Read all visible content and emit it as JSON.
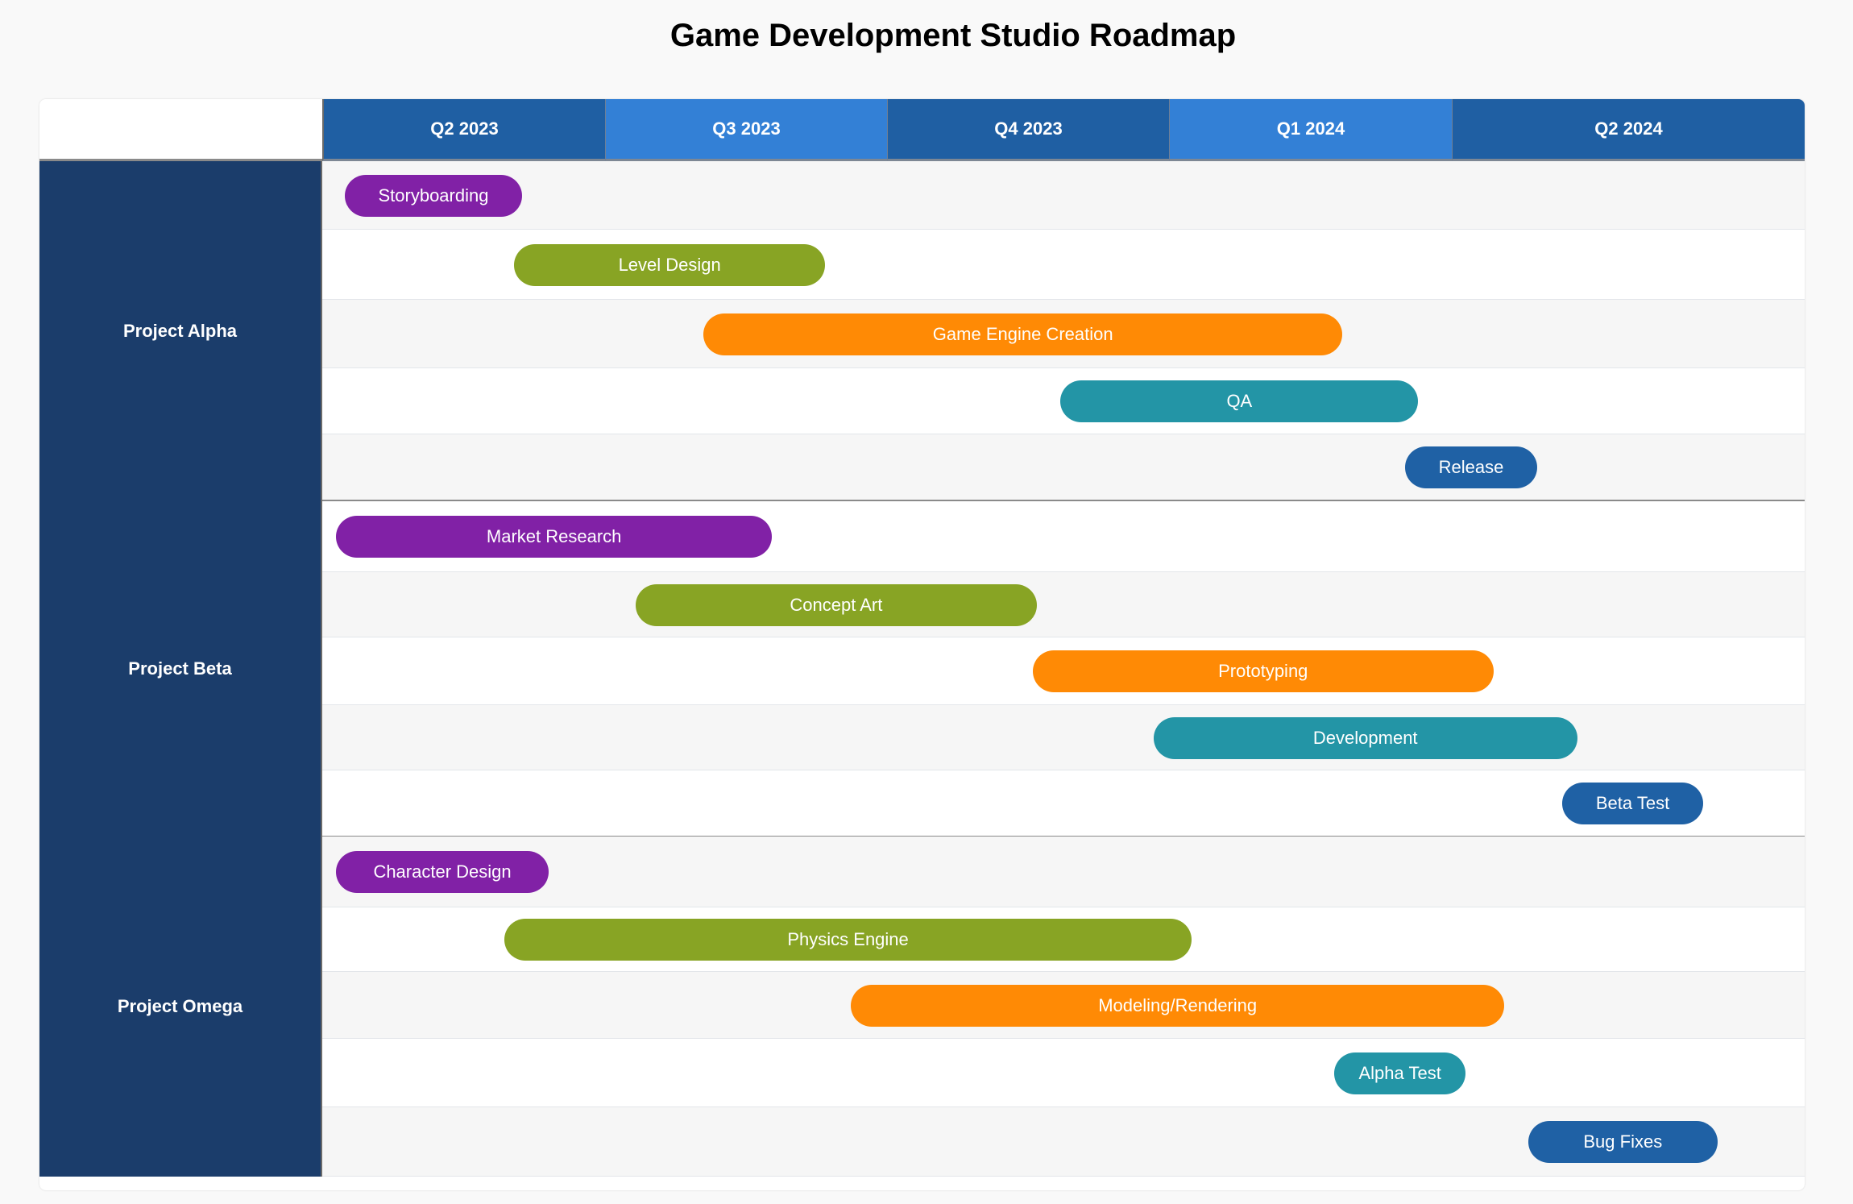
{
  "title": "Game Development Studio Roadmap",
  "chart_data": {
    "type": "gantt",
    "title": "Game Development Studio Roadmap",
    "time_unit": "months since Apr 2023",
    "time_range": [
      0,
      15
    ],
    "quarters": [
      {
        "label": "Q2 2023",
        "color": "#1f5fa3"
      },
      {
        "label": "Q3 2023",
        "color": "#3380d6"
      },
      {
        "label": "Q4 2023",
        "color": "#1f5fa3"
      },
      {
        "label": "Q1 2024",
        "color": "#3380d6"
      },
      {
        "label": "Q2 2024",
        "color": "#1f5fa3"
      }
    ],
    "groups": [
      {
        "name": "Project Alpha",
        "tasks": [
          {
            "label": "Storyboarding",
            "start": 0.23,
            "end": 2.02,
            "color": "#8121a6"
          },
          {
            "label": "Level Design",
            "start": 1.94,
            "end": 5.09,
            "color": "#88a424"
          },
          {
            "label": "Game Engine Creation",
            "start": 3.86,
            "end": 10.32,
            "color": "#ff8a05"
          },
          {
            "label": "QA",
            "start": 7.47,
            "end": 11.09,
            "color": "#2395a6"
          },
          {
            "label": "Release",
            "start": 10.96,
            "end": 12.29,
            "color": "#1f61a5"
          }
        ]
      },
      {
        "name": "Project Beta",
        "tasks": [
          {
            "label": "Market Research",
            "start": 0.14,
            "end": 4.55,
            "color": "#8121a6"
          },
          {
            "label": "Concept Art",
            "start": 3.17,
            "end": 7.23,
            "color": "#88a424"
          },
          {
            "label": "Prototyping",
            "start": 7.19,
            "end": 11.85,
            "color": "#ff8a05"
          },
          {
            "label": "Development",
            "start": 8.41,
            "end": 12.7,
            "color": "#2395a6"
          },
          {
            "label": "Beta Test",
            "start": 12.55,
            "end": 13.97,
            "color": "#1f61a5"
          }
        ]
      },
      {
        "name": "Project Omega",
        "tasks": [
          {
            "label": "Character Design",
            "start": 0.14,
            "end": 2.29,
            "color": "#8121a6"
          },
          {
            "label": "Physics Engine",
            "start": 1.84,
            "end": 8.8,
            "color": "#88a424"
          },
          {
            "label": "Modeling/Rendering",
            "start": 5.35,
            "end": 11.96,
            "color": "#ff8a05"
          },
          {
            "label": "Alpha Test",
            "start": 10.24,
            "end": 11.57,
            "color": "#2395a6"
          },
          {
            "label": "Bug Fixes",
            "start": 12.2,
            "end": 14.12,
            "color": "#1f61a5"
          }
        ]
      }
    ],
    "colors": {
      "group_label_bg": "#1b3d6b",
      "row_alt_bg": "#f6f6f6"
    }
  }
}
